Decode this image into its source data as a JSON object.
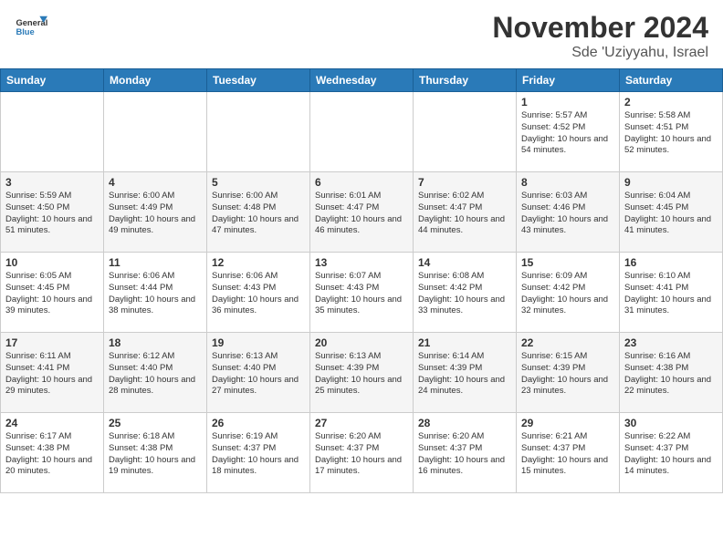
{
  "header": {
    "title": "November 2024",
    "location": "Sde 'Uziyyahu, Israel",
    "logo_general": "General",
    "logo_blue": "Blue"
  },
  "weekdays": [
    "Sunday",
    "Monday",
    "Tuesday",
    "Wednesday",
    "Thursday",
    "Friday",
    "Saturday"
  ],
  "weeks": [
    [
      {
        "day": "",
        "info": ""
      },
      {
        "day": "",
        "info": ""
      },
      {
        "day": "",
        "info": ""
      },
      {
        "day": "",
        "info": ""
      },
      {
        "day": "",
        "info": ""
      },
      {
        "day": "1",
        "info": "Sunrise: 5:57 AM\nSunset: 4:52 PM\nDaylight: 10 hours and 54 minutes."
      },
      {
        "day": "2",
        "info": "Sunrise: 5:58 AM\nSunset: 4:51 PM\nDaylight: 10 hours and 52 minutes."
      }
    ],
    [
      {
        "day": "3",
        "info": "Sunrise: 5:59 AM\nSunset: 4:50 PM\nDaylight: 10 hours and 51 minutes."
      },
      {
        "day": "4",
        "info": "Sunrise: 6:00 AM\nSunset: 4:49 PM\nDaylight: 10 hours and 49 minutes."
      },
      {
        "day": "5",
        "info": "Sunrise: 6:00 AM\nSunset: 4:48 PM\nDaylight: 10 hours and 47 minutes."
      },
      {
        "day": "6",
        "info": "Sunrise: 6:01 AM\nSunset: 4:47 PM\nDaylight: 10 hours and 46 minutes."
      },
      {
        "day": "7",
        "info": "Sunrise: 6:02 AM\nSunset: 4:47 PM\nDaylight: 10 hours and 44 minutes."
      },
      {
        "day": "8",
        "info": "Sunrise: 6:03 AM\nSunset: 4:46 PM\nDaylight: 10 hours and 43 minutes."
      },
      {
        "day": "9",
        "info": "Sunrise: 6:04 AM\nSunset: 4:45 PM\nDaylight: 10 hours and 41 minutes."
      }
    ],
    [
      {
        "day": "10",
        "info": "Sunrise: 6:05 AM\nSunset: 4:45 PM\nDaylight: 10 hours and 39 minutes."
      },
      {
        "day": "11",
        "info": "Sunrise: 6:06 AM\nSunset: 4:44 PM\nDaylight: 10 hours and 38 minutes."
      },
      {
        "day": "12",
        "info": "Sunrise: 6:06 AM\nSunset: 4:43 PM\nDaylight: 10 hours and 36 minutes."
      },
      {
        "day": "13",
        "info": "Sunrise: 6:07 AM\nSunset: 4:43 PM\nDaylight: 10 hours and 35 minutes."
      },
      {
        "day": "14",
        "info": "Sunrise: 6:08 AM\nSunset: 4:42 PM\nDaylight: 10 hours and 33 minutes."
      },
      {
        "day": "15",
        "info": "Sunrise: 6:09 AM\nSunset: 4:42 PM\nDaylight: 10 hours and 32 minutes."
      },
      {
        "day": "16",
        "info": "Sunrise: 6:10 AM\nSunset: 4:41 PM\nDaylight: 10 hours and 31 minutes."
      }
    ],
    [
      {
        "day": "17",
        "info": "Sunrise: 6:11 AM\nSunset: 4:41 PM\nDaylight: 10 hours and 29 minutes."
      },
      {
        "day": "18",
        "info": "Sunrise: 6:12 AM\nSunset: 4:40 PM\nDaylight: 10 hours and 28 minutes."
      },
      {
        "day": "19",
        "info": "Sunrise: 6:13 AM\nSunset: 4:40 PM\nDaylight: 10 hours and 27 minutes."
      },
      {
        "day": "20",
        "info": "Sunrise: 6:13 AM\nSunset: 4:39 PM\nDaylight: 10 hours and 25 minutes."
      },
      {
        "day": "21",
        "info": "Sunrise: 6:14 AM\nSunset: 4:39 PM\nDaylight: 10 hours and 24 minutes."
      },
      {
        "day": "22",
        "info": "Sunrise: 6:15 AM\nSunset: 4:39 PM\nDaylight: 10 hours and 23 minutes."
      },
      {
        "day": "23",
        "info": "Sunrise: 6:16 AM\nSunset: 4:38 PM\nDaylight: 10 hours and 22 minutes."
      }
    ],
    [
      {
        "day": "24",
        "info": "Sunrise: 6:17 AM\nSunset: 4:38 PM\nDaylight: 10 hours and 20 minutes."
      },
      {
        "day": "25",
        "info": "Sunrise: 6:18 AM\nSunset: 4:38 PM\nDaylight: 10 hours and 19 minutes."
      },
      {
        "day": "26",
        "info": "Sunrise: 6:19 AM\nSunset: 4:37 PM\nDaylight: 10 hours and 18 minutes."
      },
      {
        "day": "27",
        "info": "Sunrise: 6:20 AM\nSunset: 4:37 PM\nDaylight: 10 hours and 17 minutes."
      },
      {
        "day": "28",
        "info": "Sunrise: 6:20 AM\nSunset: 4:37 PM\nDaylight: 10 hours and 16 minutes."
      },
      {
        "day": "29",
        "info": "Sunrise: 6:21 AM\nSunset: 4:37 PM\nDaylight: 10 hours and 15 minutes."
      },
      {
        "day": "30",
        "info": "Sunrise: 6:22 AM\nSunset: 4:37 PM\nDaylight: 10 hours and 14 minutes."
      }
    ]
  ]
}
